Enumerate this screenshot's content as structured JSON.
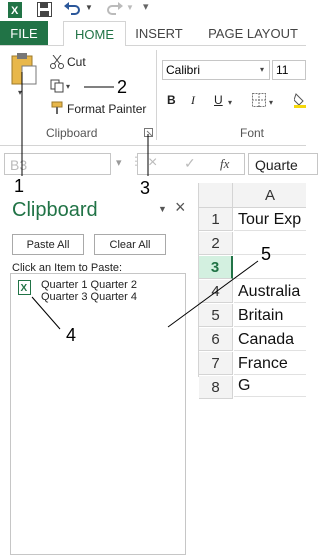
{
  "ribbon_tabs": [
    "FILE",
    "HOME",
    "INSERT",
    "PAGE LAYOUT"
  ],
  "clipboard_group": {
    "cut_label": "Cut",
    "format_painter_label": "Format Painter",
    "group_label": "Clipboard"
  },
  "font_group": {
    "font_name": "Calibri",
    "font_size": "11",
    "bold": "B",
    "italic": "I",
    "underline": "U",
    "group_label": "Font"
  },
  "formula_bar": {
    "name_box": "B3",
    "cancel": "×",
    "enter": "✓",
    "fx": "fx",
    "content": "Quarte"
  },
  "clipboard_pane": {
    "title": "Clipboard",
    "paste_all": "Paste All",
    "clear_all": "Clear All",
    "instruction": "Click an Item to Paste:",
    "item_line1": "Quarter 1 Quarter 2",
    "item_line2": "Quarter 3 Quarter 4",
    "close": "×",
    "menu": "▼"
  },
  "sheet": {
    "column": "A",
    "rows": [
      {
        "num": "1",
        "value": "Tour Exp"
      },
      {
        "num": "2",
        "value": ""
      },
      {
        "num": "3",
        "value": ""
      },
      {
        "num": "4",
        "value": "Australia"
      },
      {
        "num": "5",
        "value": "Britain"
      },
      {
        "num": "6",
        "value": "Canada"
      },
      {
        "num": "7",
        "value": "France"
      },
      {
        "num": "8",
        "value": "G"
      }
    ]
  },
  "callouts": [
    "1",
    "2",
    "3",
    "4",
    "5"
  ],
  "colors": {
    "accent": "#217346",
    "tab_text": "#444444"
  }
}
